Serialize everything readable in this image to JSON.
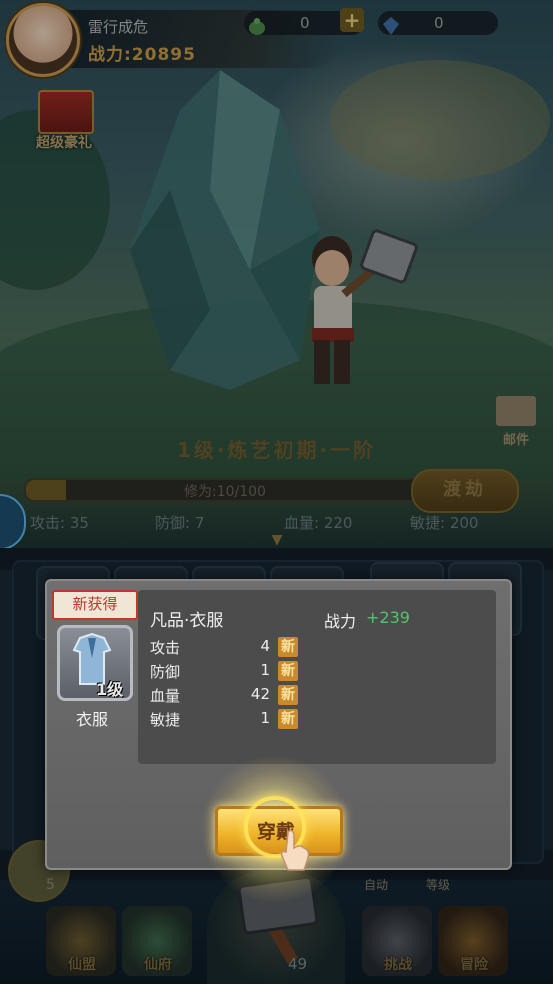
{
  "header": {
    "player_name": "雷行成危",
    "power_text": "战力:20895",
    "currency1_value": "0",
    "currency2_value": "0",
    "plus_label": "+"
  },
  "gift": {
    "label": "超级豪礼"
  },
  "mail": {
    "label": "邮件"
  },
  "stage": {
    "title": "1级·炼艺初期·一阶",
    "xp_text": "修为:10/100",
    "xp_progress": 0.1,
    "breakthrough_label": "渡劫"
  },
  "stats": {
    "attack": "攻击: 35",
    "defense": "防御: 7",
    "hp": "血量: 220",
    "agility": "敏捷: 200"
  },
  "lower": {
    "mini_num": "5",
    "auto_label": "自动",
    "level_label": "等级",
    "count": "49"
  },
  "nav": [
    {
      "label": "仙盟"
    },
    {
      "label": "仙府"
    },
    {
      "label": "挑战"
    },
    {
      "label": "冒险"
    }
  ],
  "popup": {
    "ribbon": "新获得",
    "item_level": "1级",
    "item_name": "衣服",
    "item_title": "凡品·衣服",
    "combat_label": "战力",
    "combat_value": "+239",
    "rows": [
      {
        "label": "攻击",
        "value": "4",
        "tag": "新"
      },
      {
        "label": "防御",
        "value": "1",
        "tag": "新"
      },
      {
        "label": "血量",
        "value": "42",
        "tag": "新"
      },
      {
        "label": "敏捷",
        "value": "1",
        "tag": "新"
      }
    ],
    "wear_label": "穿戴"
  },
  "colors": {
    "accent_gold": "#f0b62b",
    "power_gold": "#c89a48",
    "combat_green": "#52c46a",
    "new_tag": "#c88a2c"
  }
}
